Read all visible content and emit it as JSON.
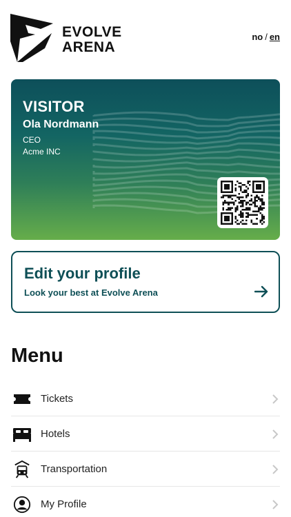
{
  "brand": {
    "line1": "EVOLVE",
    "line2": "ARENA",
    "logo_icon": "evolve-logo-mark"
  },
  "language": {
    "no": "no",
    "separator": "/",
    "en": "en",
    "active": "en"
  },
  "badge": {
    "role": "VISITOR",
    "name": "Ola Nordmann",
    "title": "CEO",
    "company": "Acme INC",
    "qr_icon": "qr-code-icon",
    "gradient_top": "#0d4f5a",
    "gradient_bottom": "#66ad4a"
  },
  "edit_profile": {
    "heading": "Edit your profile",
    "subtext": "Look your best at Evolve Arena",
    "arrow_icon": "arrow-right-icon",
    "accent": "#0e4f56"
  },
  "menu": {
    "title": "Menu",
    "items": [
      {
        "label": "Tickets",
        "icon": "ticket-icon"
      },
      {
        "label": "Hotels",
        "icon": "bed-icon"
      },
      {
        "label": "Transportation",
        "icon": "train-icon"
      },
      {
        "label": "My Profile",
        "icon": "user-icon"
      }
    ]
  }
}
